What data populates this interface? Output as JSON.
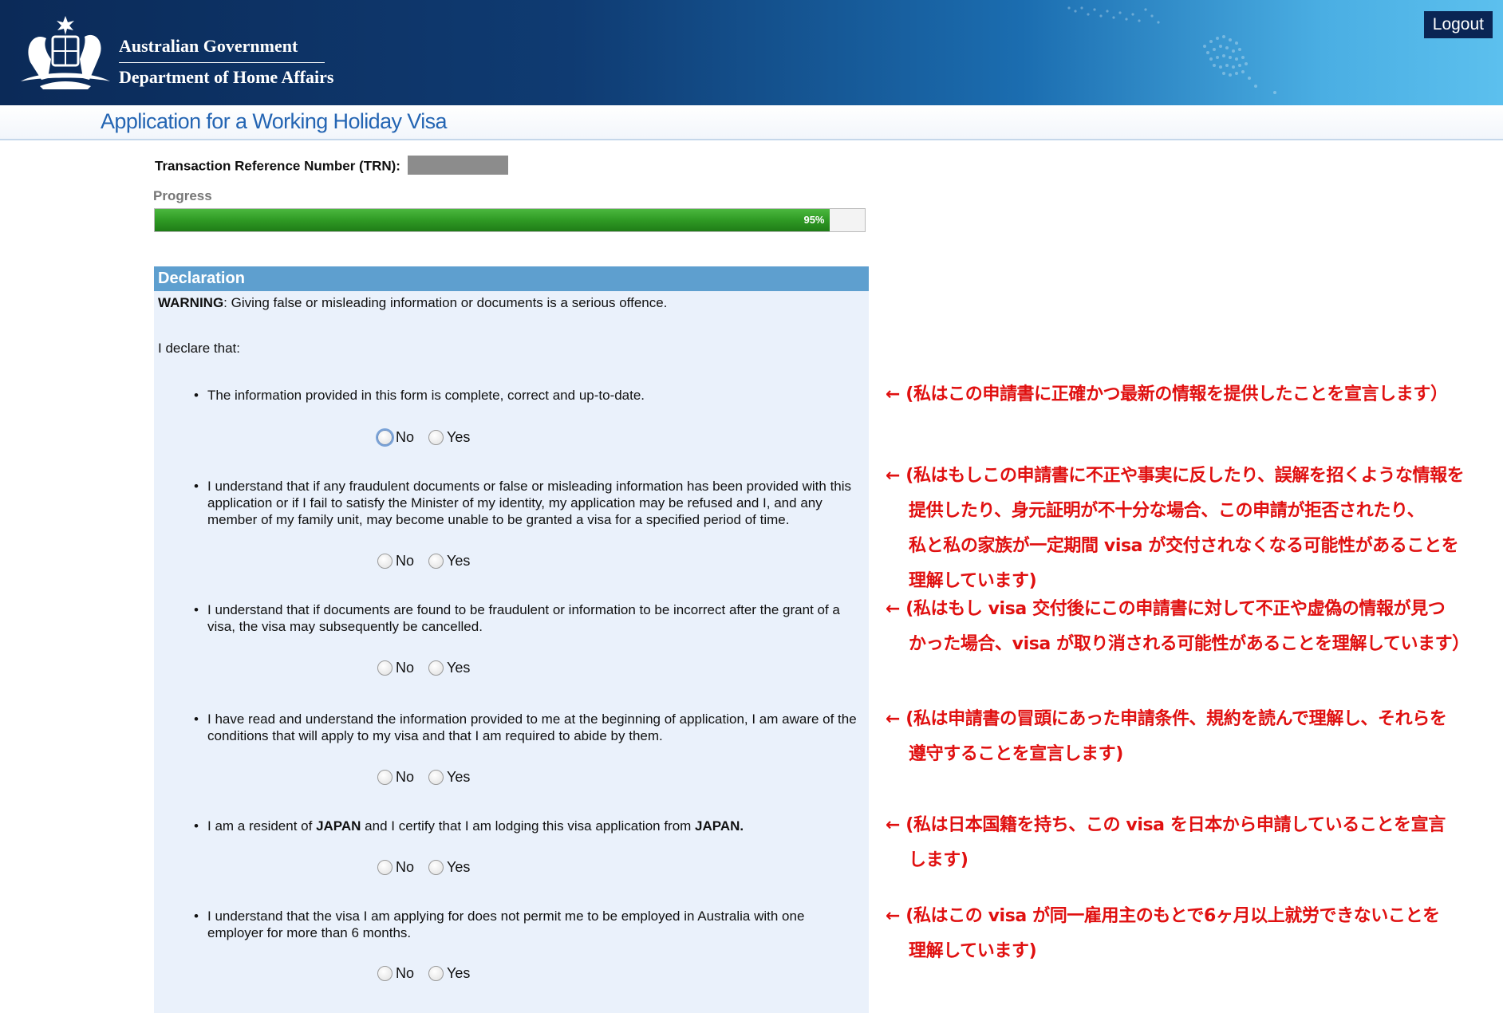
{
  "header": {
    "gov_name": "Australian Government",
    "dept_name": "Department of Home Affairs",
    "logout_label": "Logout"
  },
  "page": {
    "title": "Application for a Working Holiday Visa"
  },
  "trn": {
    "label": "Transaction Reference Number (TRN):"
  },
  "progress": {
    "label": "Progress",
    "percent": 95,
    "percent_text": "95%"
  },
  "declaration": {
    "header": "Declaration",
    "warning_label": "WARNING",
    "warning_text": ": Giving false or misleading information or documents is a serious offence.",
    "intro": "I declare that:",
    "no_label": "No",
    "yes_label": "Yes",
    "items": [
      {
        "text": "The information provided in this form is complete, correct and up-to-date."
      },
      {
        "text": "I understand that if any fraudulent documents or false or misleading information has been provided with this application or if I fail to satisfy the Minister of my identity, my application may be refused and I, and any member of my family unit, may become unable to be granted a visa for a specified period of time."
      },
      {
        "text": "I understand that if documents are found to be fraudulent or information to be incorrect after the grant of a visa, the visa may subsequently be cancelled."
      },
      {
        "text": "I have read and understand the information provided to me at the beginning of application, I am aware of the conditions that will apply to my visa and that I am required to abide by them."
      },
      {
        "text_before": "I am a resident of ",
        "country1": "JAPAN",
        "text_middle": " and I certify that I am lodging this visa application from ",
        "country2": "JAPAN."
      },
      {
        "text": "I understand that the visa I am applying for does not permit me to be employed in Australia with one employer for more than 6 months."
      }
    ]
  },
  "annotations": [
    {
      "text": "← (私はこの申請書に正確かつ最新の情報を提供したことを宣言します）"
    },
    {
      "text": "← (私はもしこの申請書に不正や事実に反したり、誤解を招くような情報を\n    提供したり、身元証明が不十分な場合、この申請が拒否されたり、\n    私と私の家族が一定期間 visa が交付されなくなる可能性があることを\n    理解しています)"
    },
    {
      "text": "← (私はもし visa 交付後にこの申請書に対して不正や虚偽の情報が見つ\n    かった場合、visa が取り消される可能性があることを理解しています）"
    },
    {
      "text": "← (私は申請書の冒頭にあった申請条件、規約を読んで理解し、それらを\n    遵守することを宣言します)"
    },
    {
      "text": "← (私は日本国籍を持ち、この visa を日本から申請していることを宣言\n    します)"
    },
    {
      "text": "← (私はこの visa が同一雇用主のもとで6ヶ月以上就労できないことを\n    理解しています)"
    }
  ]
}
